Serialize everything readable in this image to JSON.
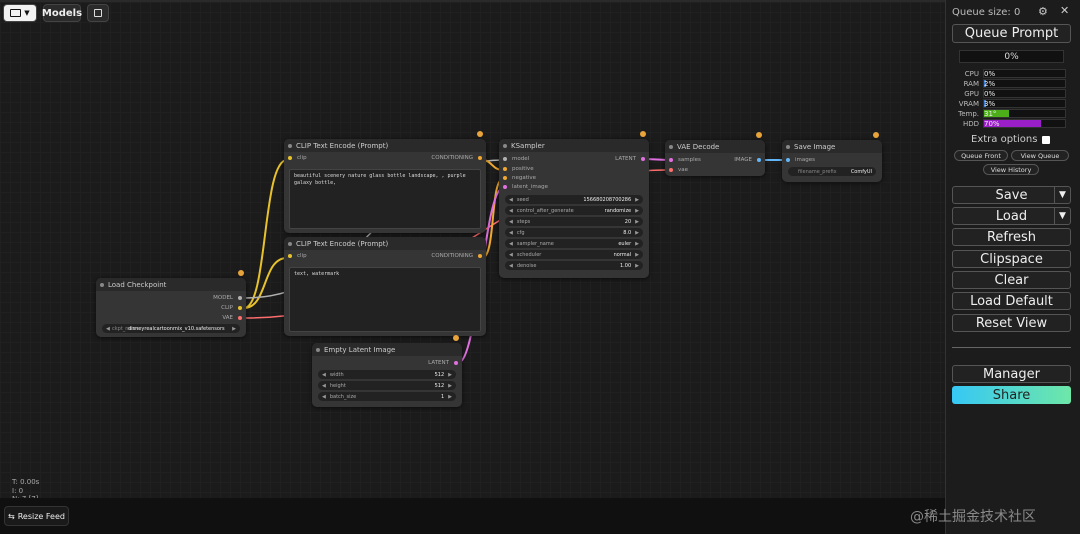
{
  "toolbar": {
    "folder_icon": "folder-icon",
    "models_label": "Models",
    "save_icon": "floppy-icon"
  },
  "canvas": {
    "stats_lines": [
      "T: 0.00s",
      "I: 0",
      "N: 7 [7]"
    ],
    "resize_feed_label": "Resize Feed"
  },
  "nodes": {
    "clip_top": {
      "title": "CLIP Text Encode (Prompt)",
      "input": "clip",
      "output": "CONDITIONING",
      "text": "beautiful scenery nature glass bottle landscape, , purple galaxy bottle,"
    },
    "clip_bottom": {
      "title": "CLIP Text Encode (Prompt)",
      "input": "clip",
      "output": "CONDITIONING",
      "text": "text, watermark"
    },
    "checkpoint": {
      "title": "Load Checkpoint",
      "outputs": [
        "MODEL",
        "CLIP",
        "VAE"
      ],
      "widget_label": "ckpt_name",
      "widget_value": "disneyrealcartoonmix_v10.safetensors"
    },
    "ksampler": {
      "title": "KSampler",
      "inputs": [
        "model",
        "positive",
        "negative",
        "latent_image"
      ],
      "output": "LATENT",
      "widgets": [
        {
          "label": "seed",
          "value": "156680208700286"
        },
        {
          "label": "control_after_generate",
          "value": "randomize"
        },
        {
          "label": "steps",
          "value": "20"
        },
        {
          "label": "cfg",
          "value": "8.0"
        },
        {
          "label": "sampler_name",
          "value": "euler"
        },
        {
          "label": "scheduler",
          "value": "normal"
        },
        {
          "label": "denoise",
          "value": "1.00"
        }
      ]
    },
    "vae_decode": {
      "title": "VAE Decode",
      "inputs": [
        "samples",
        "vae"
      ],
      "output": "IMAGE"
    },
    "save_image": {
      "title": "Save Image",
      "input": "images",
      "widget_label": "filename_prefix",
      "widget_value": "ComfyUI"
    },
    "empty_latent": {
      "title": "Empty Latent Image",
      "output": "LATENT",
      "widgets": [
        {
          "label": "width",
          "value": "512"
        },
        {
          "label": "height",
          "value": "512"
        },
        {
          "label": "batch_size",
          "value": "1"
        }
      ]
    }
  },
  "sidebar": {
    "queue_size": "Queue size: 0",
    "queue_prompt": "Queue Prompt",
    "progress": "0%",
    "stats": [
      {
        "label": "CPU",
        "value": "0%",
        "fill": 0,
        "color": "#3a7bd5"
      },
      {
        "label": "RAM",
        "value": "2%",
        "fill": 0.02,
        "color": "#3a7bd5"
      },
      {
        "label": "GPU",
        "value": "0%",
        "fill": 0,
        "color": "#3a7bd5"
      },
      {
        "label": "VRAM",
        "value": "3%",
        "fill": 0.03,
        "color": "#3a7bd5"
      },
      {
        "label": "Temp.",
        "value": "31°",
        "fill": 0.31,
        "color": "#4caf1a"
      },
      {
        "label": "HDD",
        "value": "70%",
        "fill": 0.7,
        "color": "#9b1fc9"
      }
    ],
    "extra_options": "Extra options",
    "queue_front": "Queue Front",
    "view_queue": "View Queue",
    "view_history": "View History",
    "save": "Save",
    "load": "Load",
    "refresh": "Refresh",
    "clipspace": "Clipspace",
    "clear": "Clear",
    "load_default": "Load Default",
    "reset_view": "Reset View",
    "manager": "Manager",
    "share": "Share"
  },
  "watermark": "@稀土掘金技术社区",
  "colors": {
    "clip_link": "#e8c22c",
    "model_link": "#b0b0b0",
    "vae_link": "#ff6e6e",
    "conditioning_link": "#f0a830",
    "latent_link": "#e070e0",
    "image_link": "#64b5f6",
    "share_gradient_start": "#36c8f5",
    "share_gradient_end": "#6ee7a8"
  }
}
